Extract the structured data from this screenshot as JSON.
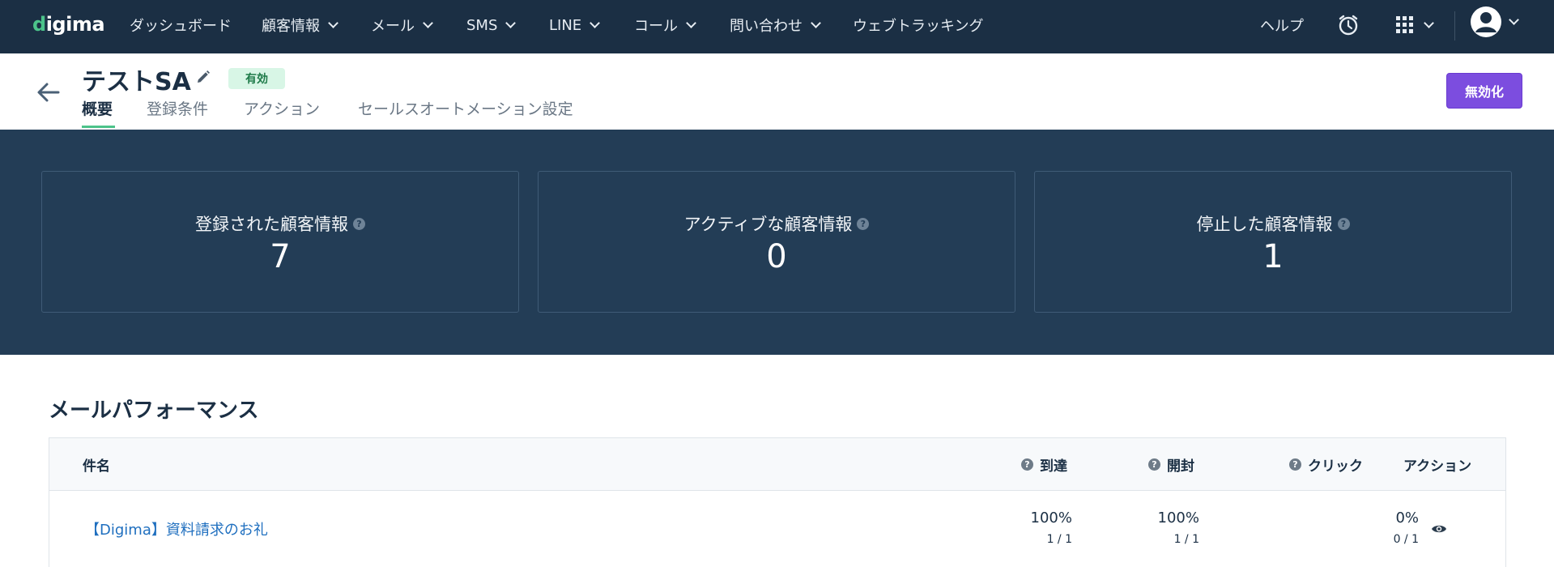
{
  "app": {
    "logo": "digima"
  },
  "nav": {
    "items": [
      {
        "label": "ダッシュボード",
        "dropdown": false
      },
      {
        "label": "顧客情報",
        "dropdown": true
      },
      {
        "label": "メール",
        "dropdown": true
      },
      {
        "label": "SMS",
        "dropdown": true
      },
      {
        "label": "LINE",
        "dropdown": true
      },
      {
        "label": "コール",
        "dropdown": true
      },
      {
        "label": "問い合わせ",
        "dropdown": true
      },
      {
        "label": "ウェブトラッキング",
        "dropdown": false
      }
    ],
    "help_label": "ヘルプ",
    "icons": [
      "alarm-clock-icon",
      "apps-grid-icon",
      "user-avatar-icon"
    ]
  },
  "header": {
    "title": "テストSA",
    "status_badge": "有効",
    "tabs": [
      {
        "label": "概要",
        "active": true
      },
      {
        "label": "登録条件",
        "active": false
      },
      {
        "label": "アクション",
        "active": false
      },
      {
        "label": "セールスオートメーション設定",
        "active": false
      }
    ],
    "disable_button": "無効化"
  },
  "stats": [
    {
      "label": "登録された顧客情報",
      "value": "7"
    },
    {
      "label": "アクティブな顧客情報",
      "value": "0"
    },
    {
      "label": "停止した顧客情報",
      "value": "1"
    }
  ],
  "mail_performance": {
    "title": "メールパフォーマンス",
    "columns": {
      "subject": "件名",
      "delivered": "到達",
      "opened": "開封",
      "clicked": "クリック",
      "action": "アクション"
    },
    "rows": [
      {
        "subject": "【Digima】資料請求のお礼",
        "delivered_pct": "100%",
        "delivered_frac": "1 / 1",
        "opened_pct": "100%",
        "opened_frac": "1 / 1",
        "clicked_pct": "0%",
        "clicked_frac": "0 / 1"
      }
    ]
  },
  "colors": {
    "nav_bg": "#1b2f44",
    "band_bg": "#233d56",
    "accent_green": "#4cc38a",
    "button_purple": "#7c4ddf",
    "link_blue": "#1f6fbf"
  }
}
